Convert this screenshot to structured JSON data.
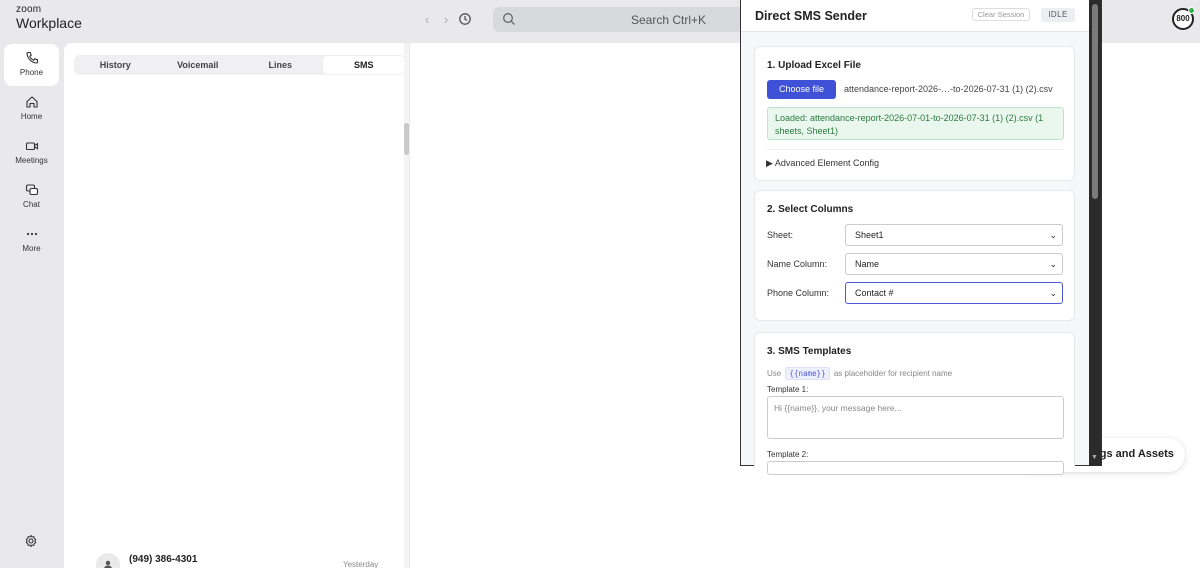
{
  "topbar": {
    "logo_top": "zoom",
    "logo_bottom": "Workplace",
    "search_placeholder": "Search Ctrl+K",
    "avatar_label": "800"
  },
  "rail": {
    "items": [
      {
        "label": "Phone",
        "icon": "phone-icon"
      },
      {
        "label": "Home",
        "icon": "home-icon"
      },
      {
        "label": "Meetings",
        "icon": "video-icon"
      },
      {
        "label": "Chat",
        "icon": "chat-icon"
      },
      {
        "label": "More",
        "icon": "more-icon"
      }
    ]
  },
  "tabs": [
    "History",
    "Voicemail",
    "Lines",
    "SMS"
  ],
  "active_tab": "SMS",
  "contact": {
    "name": "(949) 386-4301",
    "date": "Yesterday"
  },
  "pill_label": "ngs and Assets",
  "popup": {
    "title": "Direct SMS Sender",
    "clear_label": "Clear Session",
    "status": "IDLE",
    "upload": {
      "heading": "1. Upload Excel File",
      "choose_label": "Choose file",
      "file_name": "attendance-report-2026-…-to-2026-07-31 (1) (2).csv",
      "loaded_msg": "Loaded: attendance-report-2026-07-01-to-2026-07-31 (1) (2).csv (1 sheets, Sheet1)",
      "advanced": "▶ Advanced Element Config"
    },
    "columns": {
      "heading": "2. Select Columns",
      "sheet_label": "Sheet:",
      "sheet_value": "Sheet1",
      "name_label": "Name Column:",
      "name_value": "Name",
      "phone_label": "Phone Column:",
      "phone_value": "Contact #"
    },
    "templates": {
      "heading": "3. SMS Templates",
      "hint_pre": "Use",
      "hint_code": "{{name}}",
      "hint_post": "as placeholder for recipient name",
      "t1_label": "Template 1:",
      "t1_placeholder": "Hi {{name}}, your message here...",
      "t2_label": "Template 2:"
    }
  }
}
